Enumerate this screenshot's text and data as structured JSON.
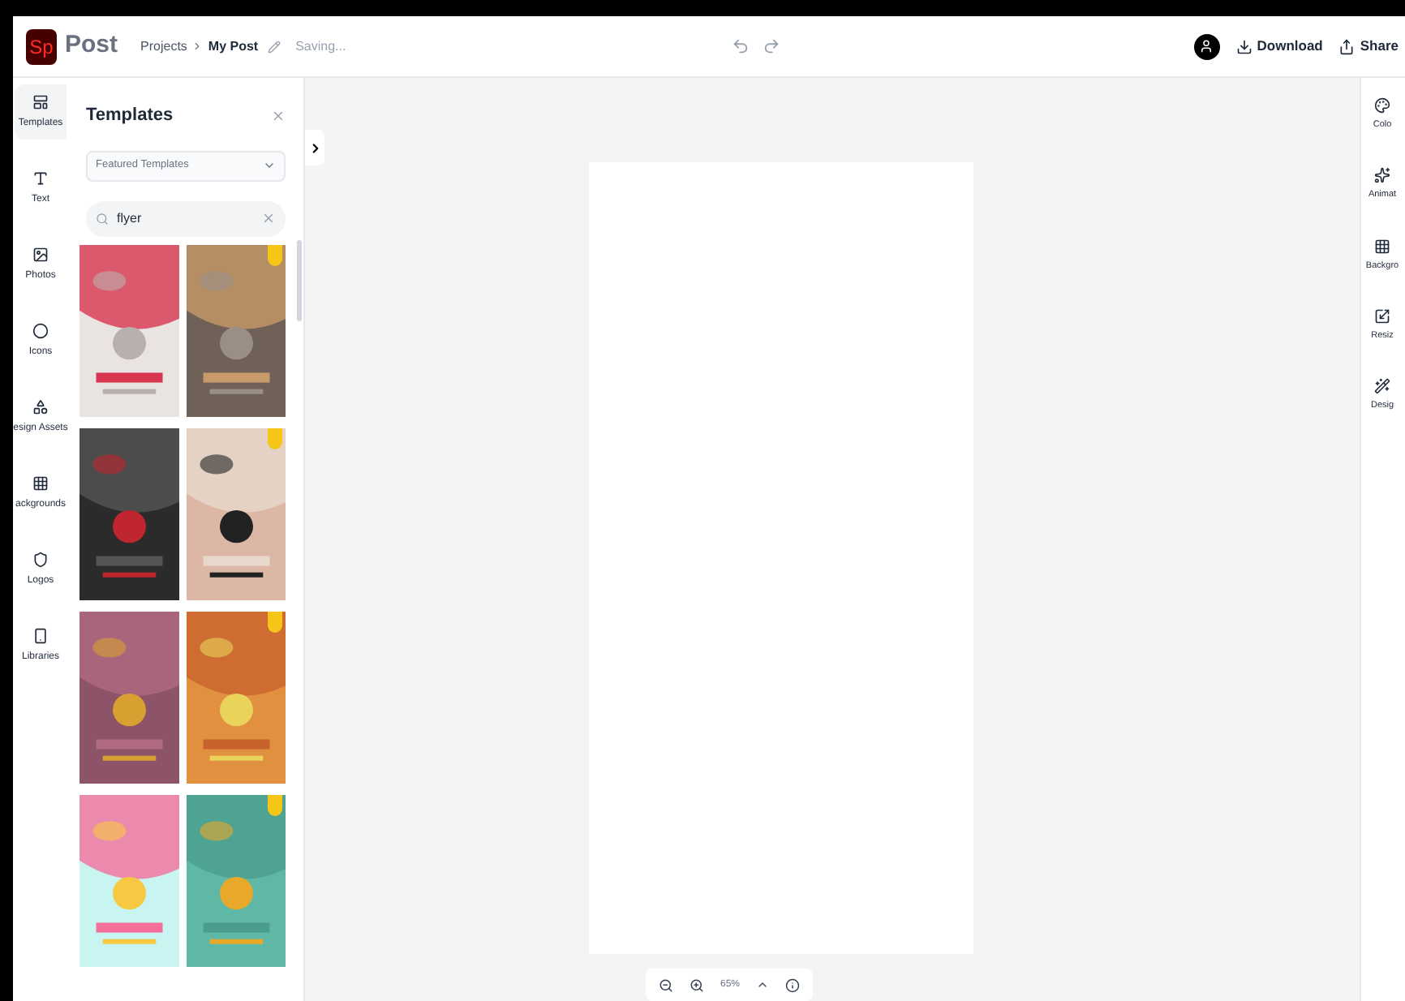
{
  "header": {
    "logo": "Sp",
    "app_name": "Post",
    "breadcrumb": [
      "Projects",
      "My Post"
    ],
    "status": "Saving...",
    "actions": [
      {
        "kind": "download",
        "label": "Download"
      },
      {
        "kind": "share",
        "label": "Share"
      }
    ]
  },
  "left_rail": [
    {
      "kind": "templates",
      "label": "Templates",
      "selected": true
    },
    {
      "kind": "text",
      "label": "Text",
      "selected": false
    },
    {
      "kind": "photos",
      "label": "Photos",
      "selected": false
    },
    {
      "kind": "icons",
      "label": "Icons",
      "selected": false
    },
    {
      "kind": "assets",
      "label": "esign Assets",
      "selected": false
    },
    {
      "kind": "backgrounds",
      "label": "ackgrounds",
      "selected": false
    },
    {
      "kind": "logos",
      "label": "Logos",
      "selected": false
    },
    {
      "kind": "libraries",
      "label": "Libraries",
      "selected": false
    }
  ],
  "panel": {
    "title": "Templates",
    "dropdown": "Featured Templates",
    "search": "flyer",
    "templates": [
      {
        "kind": "picture",
        "premium": false
      },
      {
        "kind": "picture",
        "premium": true
      },
      {
        "kind": "picture",
        "premium": false
      },
      {
        "kind": "picture",
        "premium": true
      },
      {
        "kind": "picture",
        "premium": false
      },
      {
        "kind": "picture",
        "premium": true
      },
      {
        "kind": "picture",
        "premium": false
      },
      {
        "kind": "picture",
        "premium": true
      }
    ]
  },
  "right_rail": [
    {
      "kind": "colors",
      "label": "Colo"
    },
    {
      "kind": "animate",
      "label": "Animat"
    },
    {
      "kind": "backgrounds",
      "label": "Backgro"
    },
    {
      "kind": "resize",
      "label": "Resiz"
    },
    {
      "kind": "design",
      "label": "Desig"
    }
  ],
  "zoom": {
    "value": "65%"
  }
}
